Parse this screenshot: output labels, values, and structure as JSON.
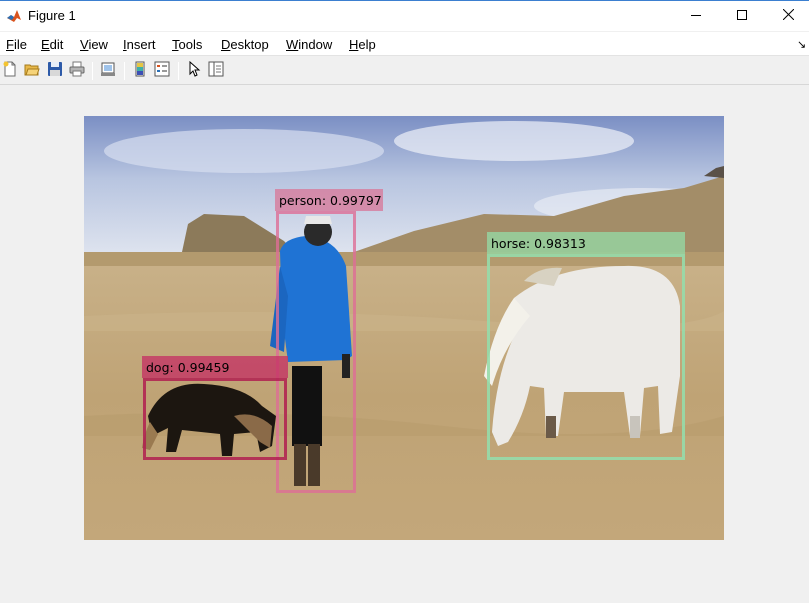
{
  "window": {
    "title": "Figure 1",
    "icon": "matlab-icon",
    "controls": [
      "minimize-icon",
      "maximize-icon",
      "close-icon"
    ]
  },
  "menu": {
    "items": [
      {
        "label": "File",
        "underline": "F",
        "rest": "ile"
      },
      {
        "label": "Edit",
        "underline": "E",
        "rest": "dit"
      },
      {
        "label": "View",
        "underline": "V",
        "rest": "iew"
      },
      {
        "label": "Insert",
        "underline": "I",
        "rest": "nsert"
      },
      {
        "label": "Tools",
        "underline": "T",
        "rest": "ools"
      },
      {
        "label": "Desktop",
        "underline": "D",
        "rest": "esktop"
      },
      {
        "label": "Window",
        "underline": "W",
        "rest": "indow"
      },
      {
        "label": "Help",
        "underline": "H",
        "rest": "elp"
      }
    ],
    "overflow_icon": "chevron-icon"
  },
  "toolbar": {
    "buttons": [
      "new-figure-icon",
      "open-file-icon",
      "save-icon",
      "print-icon",
      "link-plot-icon",
      "insert-colorbar-icon",
      "insert-legend-icon",
      "edit-plot-icon",
      "property-inspector-icon"
    ]
  },
  "detections": [
    {
      "class": "person",
      "label": "person: 0.99797",
      "score": 0.99797
    },
    {
      "class": "dog",
      "label": "dog: 0.99459",
      "score": 0.99459
    },
    {
      "class": "horse",
      "label": "horse: 0.98313",
      "score": 0.98313
    }
  ],
  "colors": {
    "person": "#dd6e96",
    "dog": "#b01e50",
    "horse": "#96dcaa"
  }
}
